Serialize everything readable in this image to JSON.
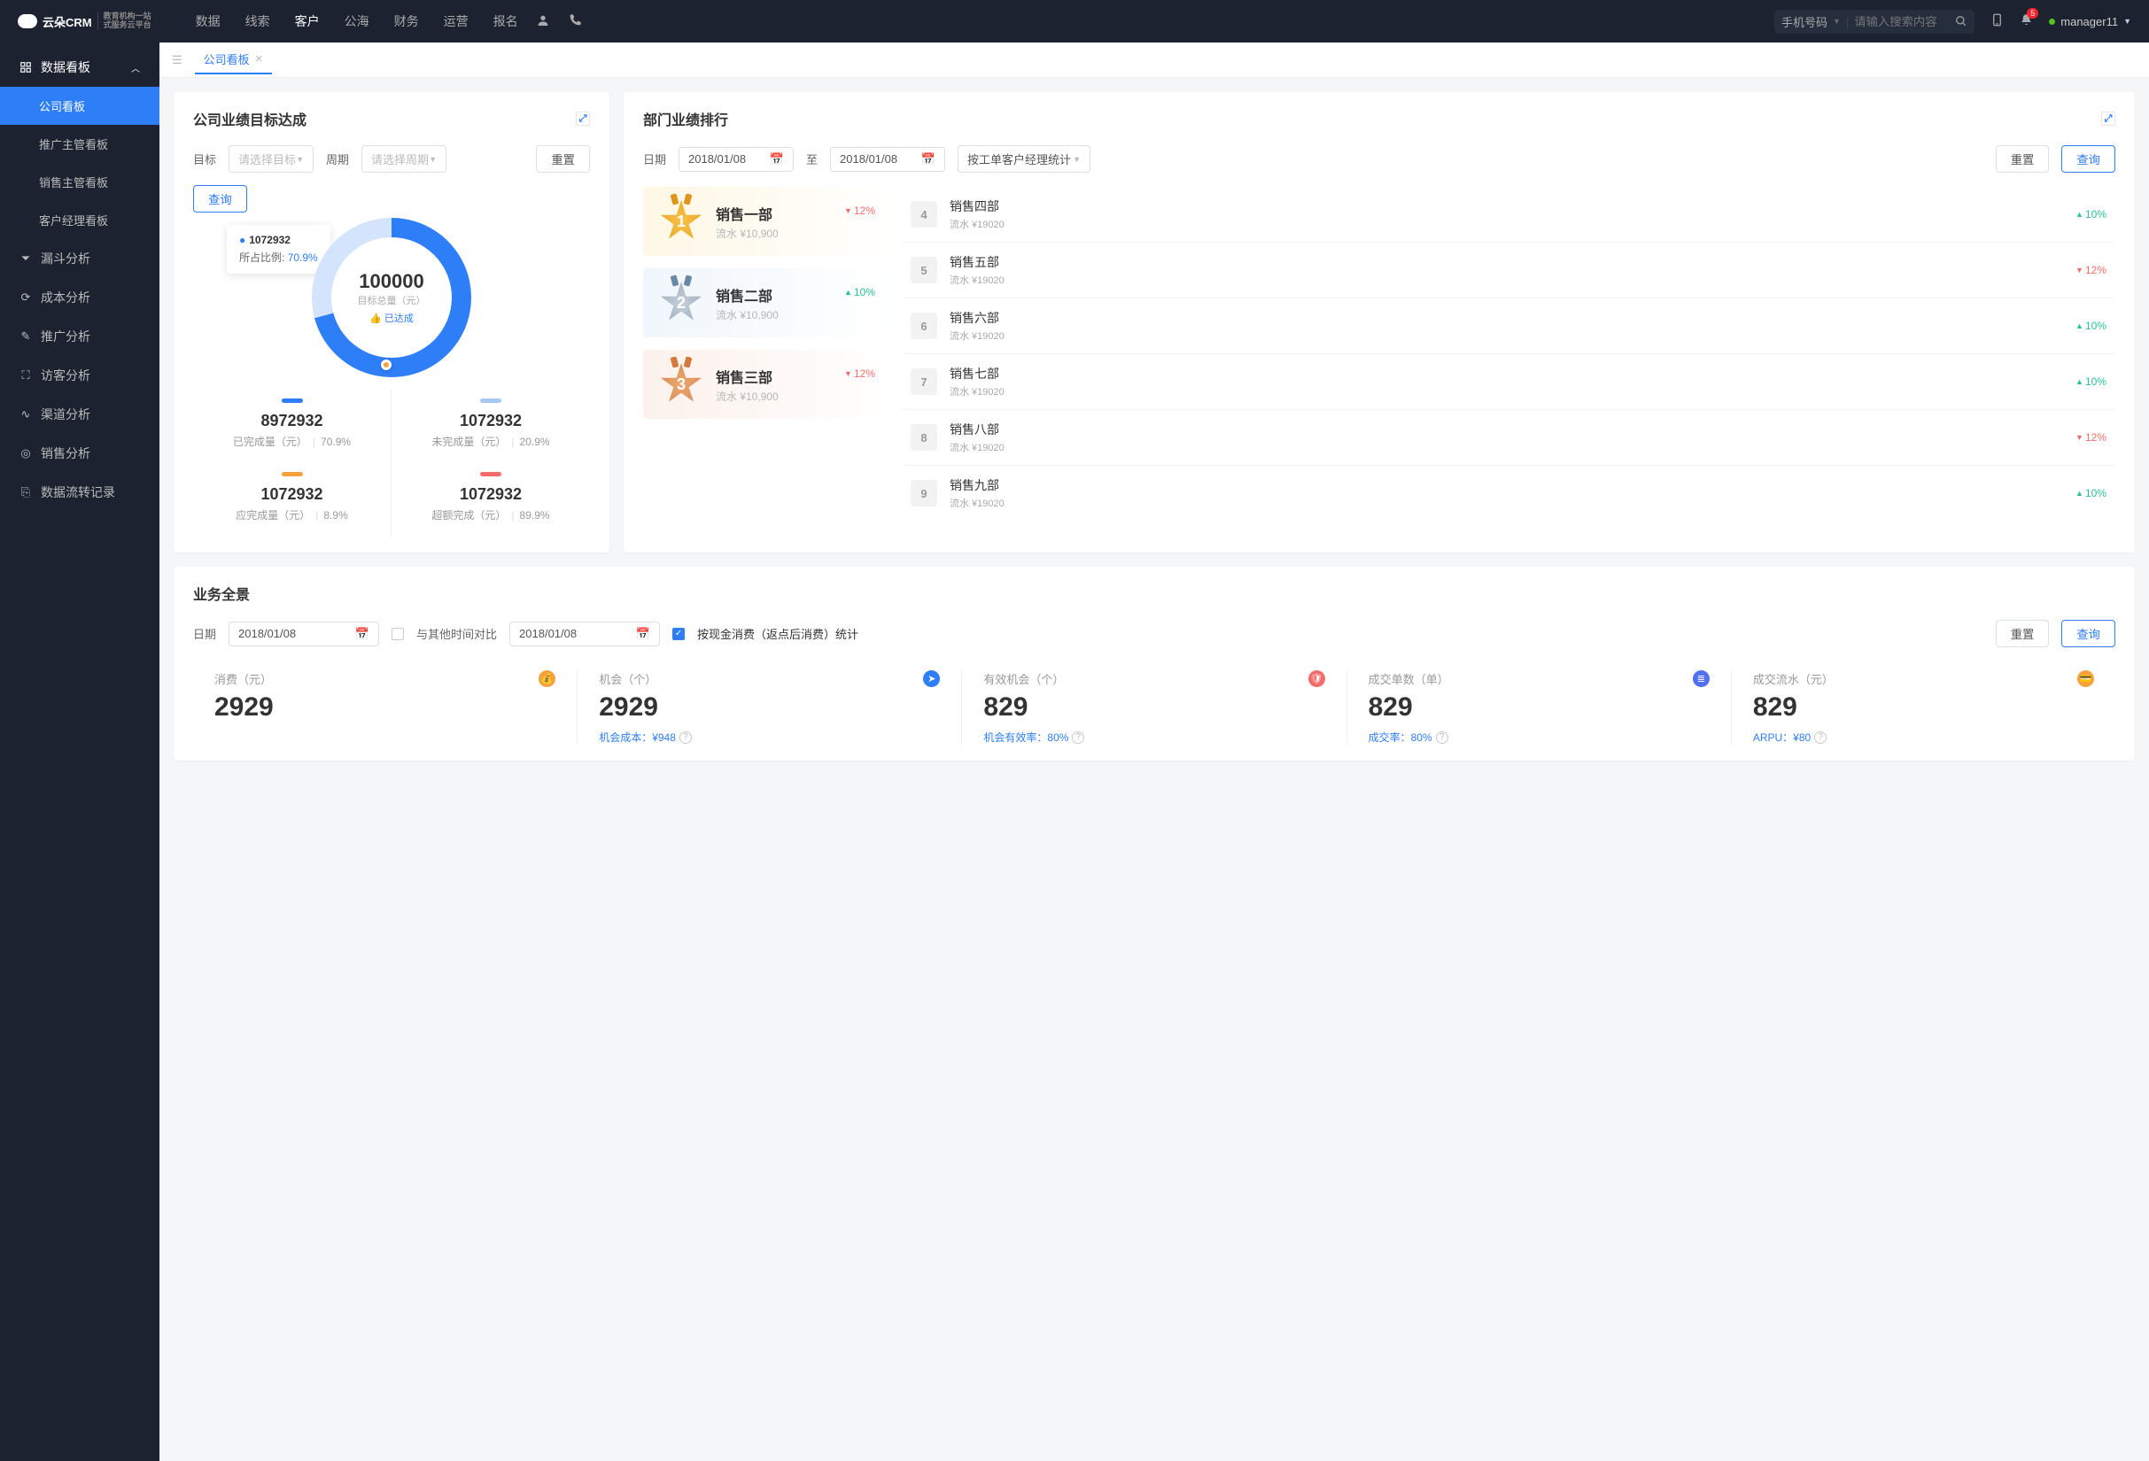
{
  "topbar": {
    "logo": "云朵CRM",
    "logo_sub1": "教育机构一站",
    "logo_sub2": "式服务云平台",
    "nav": [
      "数据",
      "线索",
      "客户",
      "公海",
      "财务",
      "运营",
      "报名"
    ],
    "nav_active": 2,
    "search_type": "手机号码",
    "search_placeholder": "请输入搜索内容",
    "notif_count": "5",
    "user": "manager11"
  },
  "sidebar": {
    "head": "数据看板",
    "subs": [
      "公司看板",
      "推广主管看板",
      "销售主管看板",
      "客户经理看板"
    ],
    "sub_active": 0,
    "items": [
      "漏斗分析",
      "成本分析",
      "推广分析",
      "访客分析",
      "渠道分析",
      "销售分析",
      "数据流转记录"
    ]
  },
  "tab": {
    "label": "公司看板"
  },
  "goal_card": {
    "title": "公司业绩目标达成",
    "lbl_target": "目标",
    "target_ph": "请选择目标",
    "lbl_period": "周期",
    "period_ph": "请选择周期",
    "btn_reset": "重置",
    "btn_query": "查询",
    "tooltip_val": "1072932",
    "tooltip_ratio_lbl": "所占比例:",
    "tooltip_ratio": "70.9%",
    "center_val": "100000",
    "center_lbl": "目标总量（元）",
    "center_achv": "已达成",
    "metrics": [
      {
        "color": "#2d7ef7",
        "val": "8972932",
        "lbl": "已完成量（元）",
        "pct": "70.9%"
      },
      {
        "color": "#a8c8f4",
        "val": "1072932",
        "lbl": "未完成量（元）",
        "pct": "20.9%"
      },
      {
        "color": "#f6a23c",
        "val": "1072932",
        "lbl": "应完成量（元）",
        "pct": "8.9%"
      },
      {
        "color": "#f56c6c",
        "val": "1072932",
        "lbl": "超额完成（元）",
        "pct": "89.9%"
      }
    ]
  },
  "rank_card": {
    "title": "部门业绩排行",
    "lbl_date": "日期",
    "date1": "2018/01/08",
    "date_to": "至",
    "date2": "2018/01/08",
    "stat_mode": "按工单客户经理统计",
    "btn_reset": "重置",
    "btn_query": "查询",
    "top3": [
      {
        "rank": "1",
        "name": "销售一部",
        "sub": "流水 ¥10,900",
        "delta": "12%",
        "dir": "down"
      },
      {
        "rank": "2",
        "name": "销售二部",
        "sub": "流水 ¥10,900",
        "delta": "10%",
        "dir": "up"
      },
      {
        "rank": "3",
        "name": "销售三部",
        "sub": "流水 ¥10,900",
        "delta": "12%",
        "dir": "down"
      }
    ],
    "rest": [
      {
        "rank": "4",
        "name": "销售四部",
        "sub": "流水 ¥19020",
        "delta": "10%",
        "dir": "up"
      },
      {
        "rank": "5",
        "name": "销售五部",
        "sub": "流水 ¥19020",
        "delta": "12%",
        "dir": "down"
      },
      {
        "rank": "6",
        "name": "销售六部",
        "sub": "流水 ¥19020",
        "delta": "10%",
        "dir": "up"
      },
      {
        "rank": "7",
        "name": "销售七部",
        "sub": "流水 ¥19020",
        "delta": "10%",
        "dir": "up"
      },
      {
        "rank": "8",
        "name": "销售八部",
        "sub": "流水 ¥19020",
        "delta": "12%",
        "dir": "down"
      },
      {
        "rank": "9",
        "name": "销售九部",
        "sub": "流水 ¥19020",
        "delta": "10%",
        "dir": "up"
      }
    ]
  },
  "overview_card": {
    "title": "业务全景",
    "lbl_date": "日期",
    "date1": "2018/01/08",
    "compare_lbl": "与其他时间对比",
    "date2": "2018/01/08",
    "check_lbl": "按现金消费（返点后消费）统计",
    "btn_reset": "重置",
    "btn_query": "查询",
    "cells": [
      {
        "label": "消费（元）",
        "val": "2929",
        "sub": "",
        "ic": "#f6a23c"
      },
      {
        "label": "机会（个）",
        "val": "2929",
        "sub": "机会成本：¥948",
        "ic": "#2d7ef7"
      },
      {
        "label": "有效机会（个）",
        "val": "829",
        "sub": "机会有效率：80%",
        "ic": "#f56c6c"
      },
      {
        "label": "成交单数（单）",
        "val": "829",
        "sub": "成交率：80%",
        "ic": "#5470f2"
      },
      {
        "label": "成交流水（元）",
        "val": "829",
        "sub": "ARPU：¥80",
        "ic": "#f6a23c"
      }
    ]
  },
  "chart_data": {
    "type": "pie",
    "title": "目标总量（元）",
    "total": 100000,
    "series": [
      {
        "name": "已完成量（元）",
        "value": 8972932,
        "pct": 70.9,
        "color": "#2d7ef7"
      },
      {
        "name": "未完成量（元）",
        "value": 1072932,
        "pct": 20.9,
        "color": "#a8c8f4"
      },
      {
        "name": "应完成量（元）",
        "value": 1072932,
        "pct": 8.9,
        "color": "#f6a23c"
      },
      {
        "name": "超额完成（元）",
        "value": 1072932,
        "pct": 89.9,
        "color": "#f56c6c"
      }
    ]
  }
}
